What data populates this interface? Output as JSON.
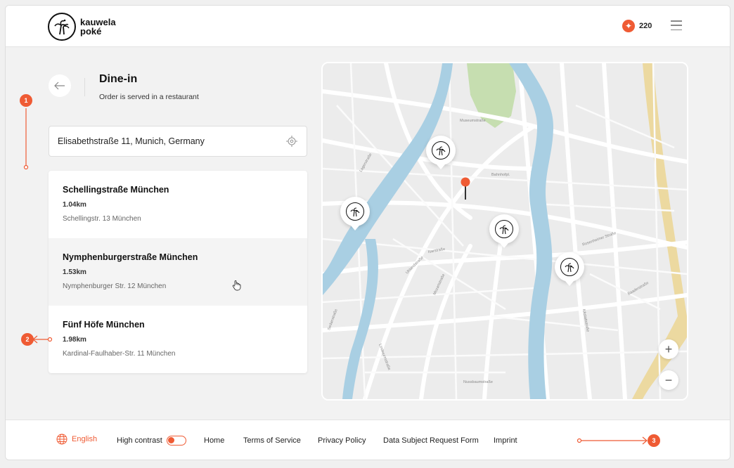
{
  "header": {
    "logo_line1": "kauwela",
    "logo_line2": "poké",
    "points": "220"
  },
  "page": {
    "title": "Dine-in",
    "subtitle": "Order is served in a restaurant"
  },
  "search": {
    "value": "Elisabethstraße 11, Munich, Germany"
  },
  "restaurants": [
    {
      "name": "Schellingstraße München",
      "distance": "1.04km",
      "address": "Schellingstr. 13 München"
    },
    {
      "name": "Nymphenburgerstraße München",
      "distance": "1.53km",
      "address": "Nymphenburger Str. 12 München"
    },
    {
      "name": "Fünf Höfe München",
      "distance": "1.98km",
      "address": "Kardinal-Faulhaber-Str. 11 München"
    }
  ],
  "annotations": [
    "1",
    "2",
    "3"
  ],
  "map": {
    "zoom_in": "+",
    "zoom_out": "−",
    "street_labels": [
      "Museumstraße",
      "Bahnhofpl.",
      "Lagerstraße",
      "Isarstraße",
      "Uhlandstraße",
      "Sedanstraße",
      "Lindwurmstraße",
      "Rosenheimer Straße",
      "Nussbaumstraße",
      "Mozartstraße",
      "Ickstattstraße",
      "Baaderstraße"
    ]
  },
  "footer": {
    "language": "English",
    "high_contrast": "High contrast",
    "links": [
      "Home",
      "Terms of Service",
      "Privacy Policy",
      "Data Subject Request Form",
      "Imprint"
    ]
  },
  "colors": {
    "accent": "#ef5b34",
    "water": "#a9cfe3",
    "park": "#c6deb0",
    "highway": "#ecd9a0"
  }
}
